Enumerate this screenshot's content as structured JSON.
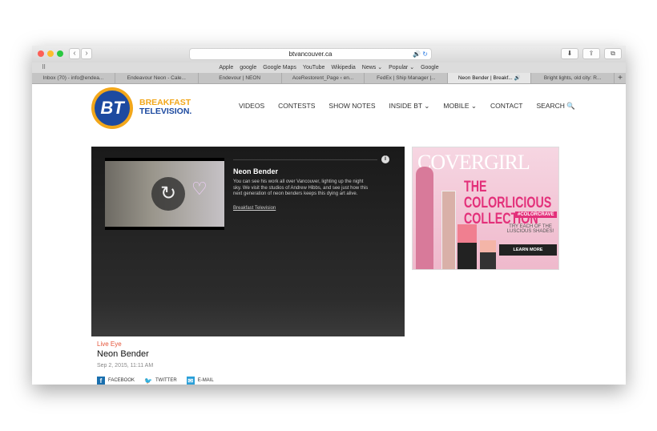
{
  "browser": {
    "url": "btvancouver.ca",
    "bookmarks": [
      "Apple",
      "google",
      "Google Maps",
      "YouTube",
      "Wikipedia",
      "News ⌄",
      "Popular ⌄",
      "Google"
    ],
    "tabs": [
      "Inbox (70) - info@endea...",
      "Endeavour Neon - Cale...",
      "Endevour | NEON",
      "AceRestorent_Page ‹ en...",
      "FedEx | Ship Manager |...",
      "Neon Bender | Breakf...  🔊",
      "Bright lights, old city: R..."
    ],
    "active_tab": 5
  },
  "site": {
    "logo_text": "BT",
    "brand_line1": "BREAKFAST",
    "brand_line2": "TELEVISION.",
    "brand_colors": {
      "orange": "#f2a71b",
      "blue": "#1d4aa0"
    },
    "nav": [
      "VIDEOS",
      "CONTESTS",
      "SHOW NOTES",
      "INSIDE BT ⌄",
      "MOBILE ⌄",
      "CONTACT",
      "SEARCH 🔍"
    ]
  },
  "player": {
    "title": "Neon Bender",
    "description": "You can see his work all over Vancouver, lighting up the night sky.  We visit the studios of Andrew Hibbs, and see just how this next generation of neon benders keeps this dying art alive.",
    "source_link": "Breakfast Television"
  },
  "ad": {
    "brand": "COVERGIRL",
    "headline": "THE COLORLICIOUS COLLECTION",
    "hashtag": "#COLORCRAVE",
    "tagline": "TRY EACH OF THE LUSCIOUS SHADES!",
    "cta": "LEARN MORE"
  },
  "article": {
    "category": "Live Eye",
    "title": "Neon Bender",
    "date": "Sep 2, 2015, 11:11 AM",
    "share": [
      "FACEBOOK",
      "TWITTER",
      "E-MAIL"
    ]
  }
}
